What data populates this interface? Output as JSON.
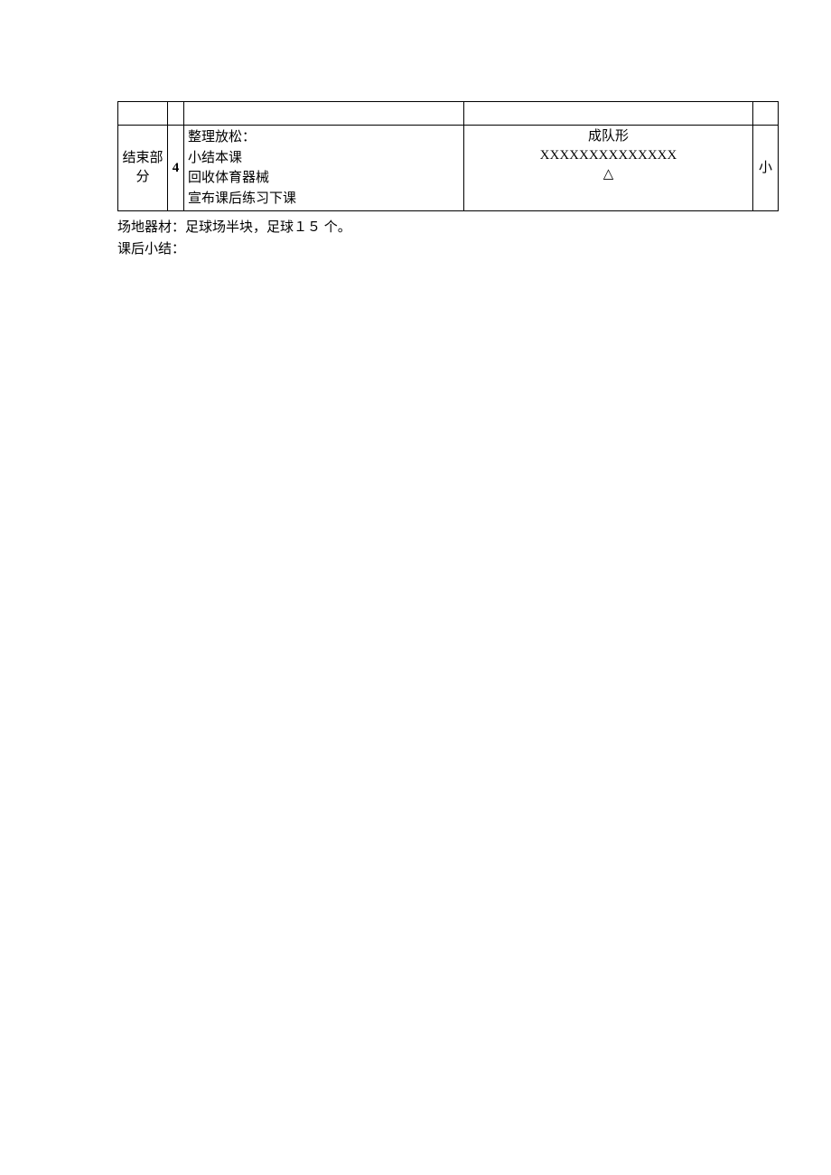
{
  "table": {
    "row2": {
      "col1": "结束部分",
      "col2": "4",
      "col3": {
        "line1": "整理放松：",
        "line2": "小结本课",
        "line3": "回收体育器械",
        "line4": "宣布课后练习下课"
      },
      "col4": {
        "line1": "成队形",
        "line2": "XXXXXXXXXXXXXX",
        "line3": "△"
      },
      "col5": "小"
    }
  },
  "footer": {
    "line1_label": "场地器材：",
    "line1_value": "足球场半块，足球１５ 个。",
    "line2_label": "课后小结："
  }
}
